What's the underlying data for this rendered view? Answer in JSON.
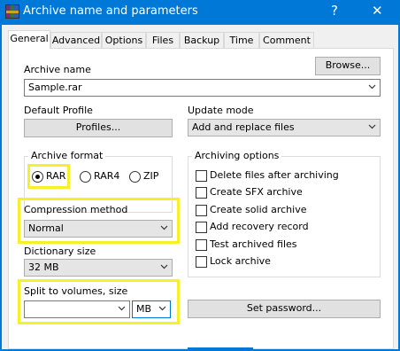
{
  "window": {
    "title": "Archive name and parameters",
    "help_label": "?",
    "close_label": "✕"
  },
  "tabs": [
    {
      "label": "General",
      "active": true
    },
    {
      "label": "Advanced"
    },
    {
      "label": "Options"
    },
    {
      "label": "Files"
    },
    {
      "label": "Backup"
    },
    {
      "label": "Time"
    },
    {
      "label": "Comment"
    }
  ],
  "archive_name": {
    "label": "Archive name",
    "value": "Sample.rar",
    "browse_label": "Browse..."
  },
  "default_profile": {
    "label": "Default Profile",
    "button_label": "Profiles..."
  },
  "update_mode": {
    "label": "Update mode",
    "value": "Add and replace files"
  },
  "archive_format": {
    "title": "Archive format",
    "options": [
      {
        "label": "RAR",
        "selected": true
      },
      {
        "label": "RAR4",
        "selected": false
      },
      {
        "label": "ZIP",
        "selected": false
      }
    ]
  },
  "compression_method": {
    "label": "Compression method",
    "value": "Normal"
  },
  "dictionary_size": {
    "label": "Dictionary size",
    "value": "32 MB"
  },
  "split_volumes": {
    "label": "Split to volumes, size",
    "value": "",
    "unit": "MB"
  },
  "archiving_options": {
    "title": "Archiving options",
    "items": [
      {
        "label": "Delete files after archiving",
        "checked": false
      },
      {
        "label": "Create SFX archive",
        "checked": false
      },
      {
        "label": "Create solid archive",
        "checked": false
      },
      {
        "label": "Add recovery record",
        "checked": false
      },
      {
        "label": "Test archived files",
        "checked": false
      },
      {
        "label": "Lock archive",
        "checked": false
      }
    ]
  },
  "set_password_label": "Set password...",
  "colors": {
    "titlebar": "#0078d7",
    "highlight": "#f5f02a"
  },
  "icons": [
    "winrar-app-icon",
    "chevron-down-icon"
  ]
}
